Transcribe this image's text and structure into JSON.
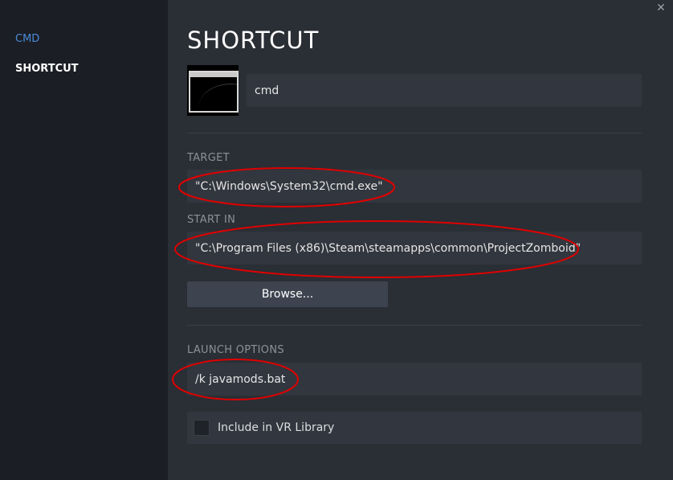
{
  "sidebar": {
    "items": [
      {
        "label": "CMD"
      },
      {
        "label": "SHORTCUT"
      }
    ]
  },
  "main": {
    "title": "SHORTCUT",
    "close_icon": "close-icon",
    "name_value": "cmd",
    "target": {
      "label": "TARGET",
      "value": "\"C:\\Windows\\System32\\cmd.exe\""
    },
    "start_in": {
      "label": "START IN",
      "value": "\"C:\\Program Files (x86)\\Steam\\steamapps\\common\\ProjectZomboid\""
    },
    "browse_label": "Browse...",
    "launch_options": {
      "label": "LAUNCH OPTIONS",
      "value": "/k javamods.bat"
    },
    "vr_library": {
      "label": "Include in VR Library",
      "checked": false
    }
  },
  "colors": {
    "sidebar_bg": "#1b1e25",
    "main_bg": "#2a2e35",
    "field_bg": "#32363e",
    "accent": "#4b8ad6",
    "annotation": "#e00000"
  }
}
